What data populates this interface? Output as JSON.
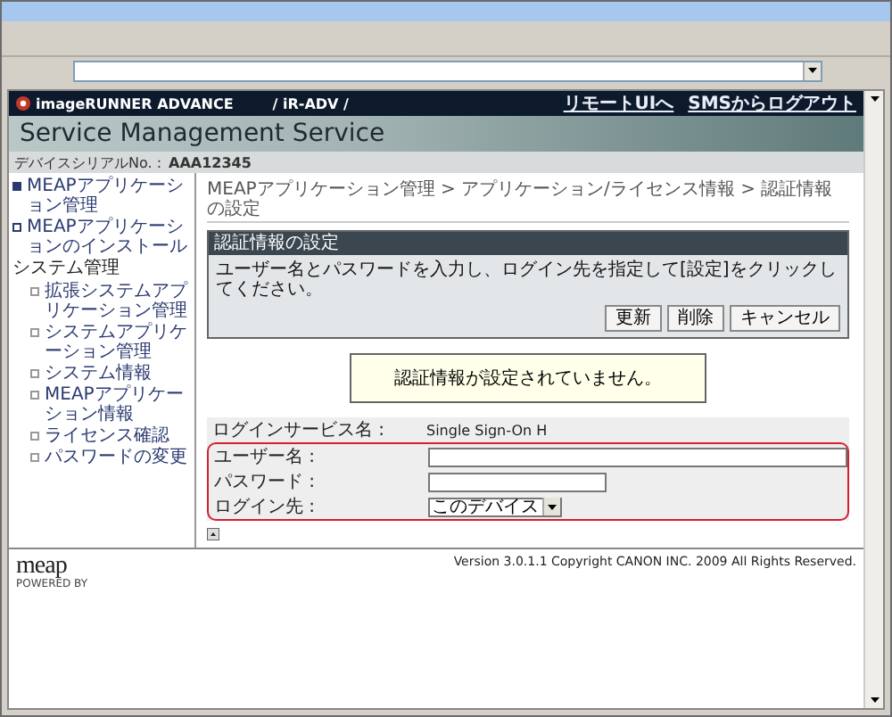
{
  "header": {
    "brand": "imageRUNNER ADVANCE",
    "model": "/ iR-ADV /",
    "links": [
      "リモートUIへ",
      "SMSからログアウト"
    ],
    "title": "Service Management Service",
    "serial_label": "デバイスシリアルNo. :",
    "serial_value": "AAA12345"
  },
  "sidebar": {
    "items": [
      {
        "label": "MEAPアプリケーション管理",
        "selected": true
      },
      {
        "label": "MEAPアプリケーションのインストール",
        "selected": false
      },
      {
        "label": "システム管理",
        "kind": "group",
        "selected": false,
        "children": [
          {
            "label": "拡張システムアプリケーション管理",
            "selected": false
          },
          {
            "label": "システムアプリケーション管理",
            "selected": false
          },
          {
            "label": "システム情報",
            "selected": false
          },
          {
            "label": "MEAPアプリケーション情報",
            "selected": false
          },
          {
            "label": "ライセンス確認",
            "selected": false
          },
          {
            "label": "パスワードの変更",
            "selected": false
          }
        ]
      }
    ]
  },
  "breadcrumb": "MEAPアプリケーション管理 > アプリケーション/ライセンス情報 > 認証情報の設定",
  "panel": {
    "title": "認証情報の設定",
    "instruction": "ユーザー名とパスワードを入力し、ログイン先を指定して[設定]をクリックしてください。",
    "buttons": [
      "更新",
      "削除",
      "キャンセル"
    ]
  },
  "notice": "認証情報が設定されていません。",
  "form": {
    "rows": [
      {
        "kind": "text",
        "label": "ログインサービス名 :",
        "value": "Single Sign-On H",
        "highlighted": false
      },
      {
        "kind": "long_input",
        "label": "ユーザー名 :",
        "highlighted": true
      },
      {
        "kind": "short_input",
        "label": "パスワード :",
        "highlighted": true
      },
      {
        "kind": "select",
        "label": "ログイン先 :",
        "value": "このデバイス",
        "highlighted": true
      }
    ]
  },
  "footer": {
    "logo": "meap",
    "powered_by": "POWERED BY",
    "version": "Version 3.0.1.1 Copyright CANON INC. 2009 All Rights Reserved."
  }
}
